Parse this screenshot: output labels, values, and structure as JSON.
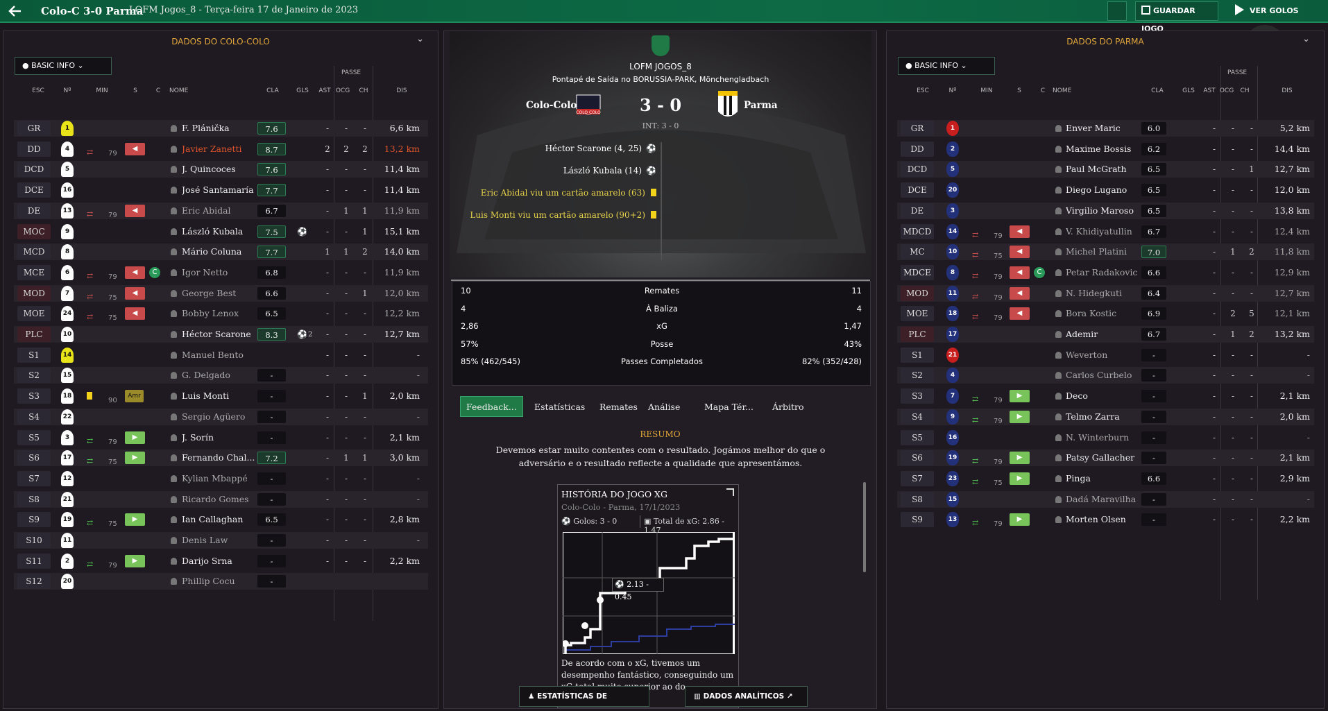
{
  "header": {
    "title": "Colo-C 3-0 Parma",
    "subtitle": "LOFM Jogos_8  - Terça-feira 17 de Janeiro de 2023",
    "save": "GUARDAR JOGO",
    "goals": "VER GOLOS"
  },
  "left": {
    "title": "DADOS DO COLO-COLO",
    "basic": "BASIC INFO",
    "pass_label": "PASSE",
    "cols": [
      "ESC",
      "Nº",
      "MIN",
      "S",
      "C",
      "NOME",
      "CLA",
      "GLS",
      "AST",
      "OCG",
      "CH",
      "DIS"
    ],
    "rows": [
      {
        "pos": "GR",
        "num": "1",
        "shirt": "yellow",
        "name": "F. Plánička",
        "rating": "7.6",
        "rh": true,
        "gls": "",
        "ast": "-",
        "ocg": "-",
        "ch": "-",
        "dis": "6,6 km"
      },
      {
        "pos": "DD",
        "num": "4",
        "shirt": "white",
        "min": "79",
        "arr": "r",
        "name": "Javier Zanetti",
        "red": true,
        "rating": "8.7",
        "rh": true,
        "ast": "2",
        "ocg": "2",
        "ch": "2",
        "dis": "13,2 km"
      },
      {
        "pos": "DCD",
        "num": "5",
        "shirt": "white",
        "name": "J. Quincoces",
        "rating": "7.6",
        "rh": true,
        "ast": "-",
        "ocg": "-",
        "ch": "-",
        "dis": "11,4 km"
      },
      {
        "pos": "DCE",
        "num": "16",
        "shirt": "white",
        "name": "José Santamaría",
        "rating": "7.7",
        "rh": true,
        "ast": "-",
        "ocg": "-",
        "ch": "-",
        "dis": "11,4 km"
      },
      {
        "pos": "DE",
        "num": "13",
        "shirt": "white",
        "min": "79",
        "arr": "r",
        "name": "Eric Abidal",
        "dim": true,
        "rating": "6.7",
        "ast": "-",
        "ocg": "1",
        "ch": "1",
        "dis": "11,9 km"
      },
      {
        "pos": "MOC",
        "num": "9",
        "shirt": "white",
        "pr": true,
        "name": "László Kubala",
        "rating": "7.5",
        "rh": true,
        "gl": true,
        "ast": "-",
        "ocg": "-",
        "ch": "1",
        "dis": "15,1 km"
      },
      {
        "pos": "MCD",
        "num": "8",
        "shirt": "white",
        "name": "Mário Coluna",
        "rating": "7.7",
        "rh": true,
        "ast": "1",
        "ocg": "1",
        "ch": "2",
        "dis": "14,0 km"
      },
      {
        "pos": "MCE",
        "num": "6",
        "shirt": "white",
        "min": "79",
        "arr": "r",
        "cap": true,
        "name": "Igor Netto",
        "dim": true,
        "rating": "6.8",
        "ast": "-",
        "ocg": "-",
        "ch": "-",
        "dis": "11,9 km"
      },
      {
        "pos": "MOD",
        "num": "7",
        "shirt": "white",
        "pr": true,
        "min": "75",
        "arr": "r",
        "name": "George Best",
        "dim": true,
        "rating": "6.6",
        "ast": "-",
        "ocg": "-",
        "ch": "1",
        "dis": "12,0 km"
      },
      {
        "pos": "MOE",
        "num": "24",
        "shirt": "white",
        "min": "75",
        "arr": "r",
        "name": "Bobby Lenox",
        "dim": true,
        "rating": "6.5",
        "ast": "-",
        "ocg": "-",
        "ch": "-",
        "dis": "12,2 km"
      },
      {
        "pos": "PLC",
        "num": "10",
        "shirt": "white",
        "pr": true,
        "name": "Héctor Scarone",
        "rating": "8.3",
        "rh": true,
        "gl": true,
        "gls": "2",
        "ast": "-",
        "ocg": "-",
        "ch": "-",
        "dis": "12,7 km"
      },
      {
        "pos": "S1",
        "num": "14",
        "shirt": "yellow",
        "name": "Manuel Bento",
        "dim": true,
        "rating": "",
        "ast": "-",
        "ocg": "-",
        "ch": "-",
        "dis": "-"
      },
      {
        "pos": "S2",
        "num": "15",
        "shirt": "white",
        "name": "G. Delgado",
        "dim": true,
        "rating": "-",
        "ast": "-",
        "ocg": "-",
        "ch": "-",
        "dis": "-"
      },
      {
        "pos": "S3",
        "num": "18",
        "shirt": "white",
        "yc": true,
        "min": "90",
        "amr": "Amr",
        "name": "Luis Monti",
        "rating": "-",
        "ast": "-",
        "ocg": "-",
        "ch": "1",
        "dis": "2,0 km"
      },
      {
        "pos": "S4",
        "num": "22",
        "shirt": "white",
        "name": "Sergio Agüero",
        "dim": true,
        "rating": "-",
        "ast": "-",
        "ocg": "-",
        "ch": "-",
        "dis": "-"
      },
      {
        "pos": "S5",
        "num": "3",
        "shirt": "white",
        "min": "79",
        "arr": "g",
        "name": "J. Sorín",
        "rating": "-",
        "ast": "-",
        "ocg": "-",
        "ch": "-",
        "dis": "2,1 km"
      },
      {
        "pos": "S6",
        "num": "17",
        "shirt": "white",
        "min": "75",
        "arr": "g",
        "name": "Fernando Chal...",
        "rating": "7.2",
        "rh": true,
        "ast": "-",
        "ocg": "1",
        "ch": "1",
        "dis": "3,0 km"
      },
      {
        "pos": "S7",
        "num": "12",
        "shirt": "white",
        "name": "Kylian Mbappé",
        "dim": true,
        "rating": "-",
        "ast": "-",
        "ocg": "-",
        "ch": "-",
        "dis": "-"
      },
      {
        "pos": "S8",
        "num": "21",
        "shirt": "white",
        "name": "Ricardo Gomes",
        "dim": true,
        "rating": "-",
        "ast": "-",
        "ocg": "-",
        "ch": "-",
        "dis": "-"
      },
      {
        "pos": "S9",
        "num": "19",
        "shirt": "white",
        "min": "75",
        "arr": "g",
        "name": "Ian Callaghan",
        "rating": "6.5",
        "ast": "-",
        "ocg": "-",
        "ch": "-",
        "dis": "2,8 km"
      },
      {
        "pos": "S10",
        "num": "11",
        "shirt": "white",
        "name": "Denis Law",
        "dim": true,
        "rating": "-",
        "ast": "-",
        "ocg": "-",
        "ch": "-",
        "dis": "-"
      },
      {
        "pos": "S11",
        "num": "2",
        "shirt": "white",
        "min": "79",
        "arr": "g",
        "name": "Darijo Srna",
        "rating": "-",
        "ast": "-",
        "ocg": "-",
        "ch": "-",
        "dis": "2,2 km"
      },
      {
        "pos": "S12",
        "num": "20",
        "shirt": "white",
        "name": "Phillip Cocu",
        "dim": true,
        "rating": "-",
        "ast": "",
        "ocg": "",
        "ch": "",
        "dis": ""
      }
    ]
  },
  "right": {
    "title": "DADOS DO PARMA",
    "basic": "BASIC INFO",
    "pass_label": "PASSE",
    "cols": [
      "ESC",
      "Nº",
      "MIN",
      "S",
      "C",
      "NOME",
      "CLA",
      "GLS",
      "AST",
      "OCG",
      "CH",
      "DIS"
    ],
    "rows": [
      {
        "pos": "GR",
        "num": "1",
        "shirt": "red",
        "name": "Enver Maric",
        "rating": "6.0",
        "ast": "-",
        "ocg": "-",
        "ch": "-",
        "dis": "5,2 km"
      },
      {
        "pos": "DD",
        "num": "2",
        "shirt": "blue",
        "name": "Maxime Bossis",
        "rating": "6.2",
        "ast": "-",
        "ocg": "-",
        "ch": "-",
        "dis": "14,4 km"
      },
      {
        "pos": "DCD",
        "num": "5",
        "shirt": "blue",
        "name": "Paul McGrath",
        "rating": "6.5",
        "ast": "-",
        "ocg": "-",
        "ch": "1",
        "dis": "12,7 km"
      },
      {
        "pos": "DCE",
        "num": "20",
        "shirt": "blue",
        "name": "Diego Lugano",
        "rating": "6.5",
        "ast": "-",
        "ocg": "-",
        "ch": "-",
        "dis": "12,0 km"
      },
      {
        "pos": "DE",
        "num": "3",
        "shirt": "blue",
        "name": "Virgilio Maroso",
        "rating": "6.5",
        "ast": "-",
        "ocg": "-",
        "ch": "-",
        "dis": "13,8 km"
      },
      {
        "pos": "MDCD",
        "num": "14",
        "shirt": "blue",
        "min": "79",
        "arr": "r",
        "name": "V. Khidiyatullin",
        "dim": true,
        "rating": "6.7",
        "ast": "-",
        "ocg": "-",
        "ch": "-",
        "dis": "12,4 km"
      },
      {
        "pos": "MC",
        "num": "10",
        "shirt": "blue",
        "min": "75",
        "arr": "r",
        "name": "Michel Platini",
        "dim": true,
        "rating": "7.0",
        "rh": true,
        "ast": "-",
        "ocg": "1",
        "ch": "2",
        "dis": "11,8 km"
      },
      {
        "pos": "MDCE",
        "num": "8",
        "shirt": "blue",
        "min": "79",
        "arr": "r",
        "cap": true,
        "name": "Petar Radakovic",
        "dim": true,
        "rating": "6.6",
        "ast": "-",
        "ocg": "-",
        "ch": "-",
        "dis": "12,9 km"
      },
      {
        "pos": "MOD",
        "num": "11",
        "shirt": "blue",
        "pr": true,
        "min": "79",
        "arr": "r",
        "name": "N. Hidegkuti",
        "dim": true,
        "rating": "6.4",
        "ast": "-",
        "ocg": "-",
        "ch": "-",
        "dis": "12,7 km"
      },
      {
        "pos": "MOE",
        "num": "18",
        "shirt": "blue",
        "min": "79",
        "arr": "r",
        "name": "Bora Kostic",
        "dim": true,
        "rating": "6.9",
        "ast": "-",
        "ocg": "2",
        "ch": "5",
        "dis": "12,1 km"
      },
      {
        "pos": "PLC",
        "num": "17",
        "shirt": "blue",
        "pr": true,
        "name": "Ademir",
        "rating": "6.7",
        "ast": "-",
        "ocg": "1",
        "ch": "2",
        "dis": "13,2 km"
      },
      {
        "pos": "S1",
        "num": "21",
        "shirt": "red",
        "name": "Weverton",
        "dim": true,
        "rating": "-",
        "ast": "-",
        "ocg": "-",
        "ch": "-",
        "dis": "-"
      },
      {
        "pos": "S2",
        "num": "4",
        "shirt": "blue",
        "name": "Carlos Curbelo",
        "dim": true,
        "rating": "-",
        "ast": "-",
        "ocg": "-",
        "ch": "-",
        "dis": "-"
      },
      {
        "pos": "S3",
        "num": "7",
        "shirt": "blue",
        "min": "79",
        "arr": "g",
        "name": "Deco",
        "rating": "-",
        "ast": "-",
        "ocg": "-",
        "ch": "-",
        "dis": "2,1 km"
      },
      {
        "pos": "S4",
        "num": "9",
        "shirt": "blue",
        "min": "79",
        "arr": "g",
        "name": "Telmo Zarra",
        "rating": "-",
        "ast": "-",
        "ocg": "-",
        "ch": "-",
        "dis": "2,0 km"
      },
      {
        "pos": "S5",
        "num": "16",
        "shirt": "blue",
        "name": "N. Winterburn",
        "dim": true,
        "rating": "-",
        "ast": "-",
        "ocg": "-",
        "ch": "-",
        "dis": "-"
      },
      {
        "pos": "S6",
        "num": "19",
        "shirt": "blue",
        "min": "79",
        "arr": "g",
        "name": "Patsy Gallacher",
        "rating": "-",
        "ast": "-",
        "ocg": "-",
        "ch": "-",
        "dis": "2,1 km"
      },
      {
        "pos": "S7",
        "num": "23",
        "shirt": "blue",
        "min": "75",
        "arr": "g",
        "name": "Pinga",
        "rating": "6.6",
        "ast": "-",
        "ocg": "-",
        "ch": "-",
        "dis": "2,9 km"
      },
      {
        "pos": "S8",
        "num": "15",
        "shirt": "blue",
        "name": "Dadá Maravilha",
        "dim": true,
        "rating": "-",
        "ast": "-",
        "ocg": "-",
        "ch": "-",
        "dis": "-"
      },
      {
        "pos": "S9",
        "num": "13",
        "shirt": "blue",
        "min": "79",
        "arr": "g",
        "name": "Morten Olsen",
        "rating": "-",
        "ast": "-",
        "ocg": "-",
        "ch": "-",
        "dis": "2,2 km"
      }
    ]
  },
  "match": {
    "comp": "LOFM JOGOS_8",
    "venue": "Pontapé de Saída no BORUSSIA-PARK, Mönchengladbach",
    "home": "Colo-Colo",
    "away": "Parma",
    "score": "3 - 0",
    "ht": "INT: 3 - 0",
    "events": [
      {
        "t": "Héctor Scarone (4, 25)",
        "k": "goal"
      },
      {
        "t": "László Kubala (14)",
        "k": "goal"
      },
      {
        "t": "Eric Abidal viu um cartão amarelo (63)",
        "k": "card"
      },
      {
        "t": "Luis Monti viu um cartão amarelo (90+2)",
        "k": "card"
      }
    ]
  },
  "stats": [
    {
      "l": "10",
      "m": "Remates",
      "r": "11"
    },
    {
      "l": "4",
      "m": "À Baliza",
      "r": "4"
    },
    {
      "l": "2,86",
      "m": "xG",
      "r": "1,47"
    },
    {
      "l": "57%",
      "m": "Posse",
      "r": "43%"
    },
    {
      "l": "85% (462/545)",
      "m": "Passes Completados",
      "r": "82% (352/428)"
    }
  ],
  "tabs": [
    "Feedback...",
    "Estatísticas",
    "Remates",
    "Análise",
    "Mapa Tér...",
    "Árbitro"
  ],
  "summary": {
    "title": "RESUMO",
    "text": "Devemos estar muito contentes com o resultado. Jogámos melhor do que o adversário e o resultado reflecte a qualidade que apresentámos."
  },
  "xg": {
    "title": "HISTÓRIA DO JOGO XG",
    "sub": "Colo-Colo - Parma, 17/1/2023",
    "goals": "Golos: 3 - 0",
    "total": "Total de xG: 2.86 - 1.47",
    "tip": "2.13 - 0.45",
    "text": "De acordo com o xG, tivemos um desempenho fantástico, conseguindo um xG total muito superior ao do adversário."
  },
  "buttons": {
    "players": "ESTATÍSTICAS DE JOGADORES",
    "analytics": "DADOS ANALÍTICOS"
  },
  "colors": {
    "accent": "#e0a63a",
    "green": "#1f7a45",
    "red_arrow": "#c94a4a",
    "green_arrow": "#78c35a"
  }
}
